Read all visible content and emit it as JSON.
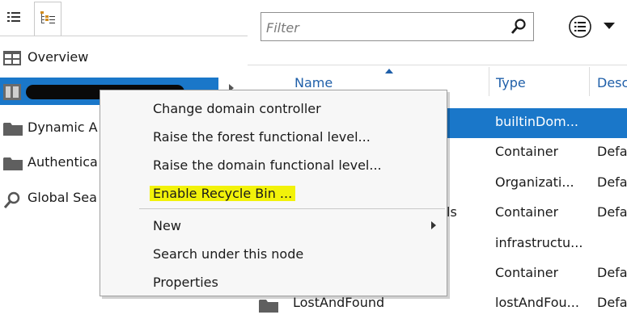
{
  "nav": {
    "items": [
      {
        "label": "Overview",
        "icon": "overview-icon"
      },
      {
        "label": "",
        "suffix": "...",
        "icon": "domain-icon",
        "selected": true,
        "redacted": true
      },
      {
        "label": "Dynamic A",
        "icon": "folder-icon"
      },
      {
        "label": "Authentica",
        "icon": "folder-icon"
      },
      {
        "label": "Global Sea",
        "icon": "search-icon"
      }
    ]
  },
  "filter": {
    "placeholder": "Filter"
  },
  "grid": {
    "columns": [
      "Name",
      "Type",
      "Desc"
    ],
    "rows": [
      {
        "name": "",
        "type": "builtinDom...",
        "desc": "",
        "selected": true
      },
      {
        "name": "",
        "type": "Container",
        "desc": "Defa"
      },
      {
        "name": "",
        "type": "Organizati...",
        "desc": "Defa"
      },
      {
        "name": "ls",
        "type": "Container",
        "desc": "Defa"
      },
      {
        "name": "",
        "type": "infrastructu...",
        "desc": ""
      },
      {
        "name": "",
        "type": "Container",
        "desc": "Defa"
      },
      {
        "name": "LostAndFound",
        "type": "lostAndFou...",
        "desc": "Defa"
      }
    ]
  },
  "context_menu": {
    "items": [
      "Change domain controller",
      "Raise the forest functional level...",
      "Raise the domain functional level...",
      "Enable Recycle Bin ...",
      "New",
      "Search under this node",
      "Properties"
    ],
    "highlighted_color": "#f2f20a"
  },
  "colors": {
    "selection": "#1a77c9",
    "header_text": "#1f5fa9"
  }
}
